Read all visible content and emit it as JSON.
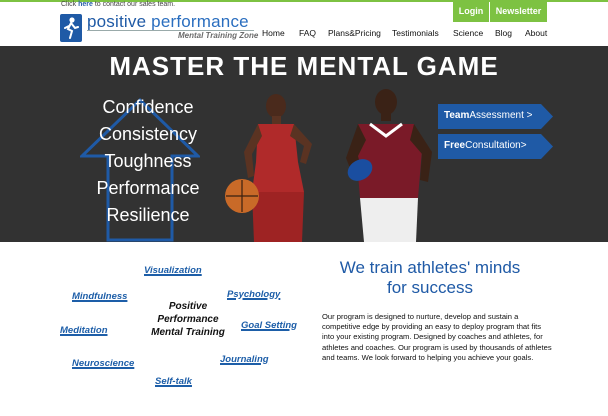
{
  "header": {
    "contact_link": "here",
    "contact_suffix": " to contact our sales team.",
    "contact_prefix": "Click ",
    "logo_name_1": "positive",
    "logo_name_2": " performance",
    "logo_tagline": "Mental Training Zone",
    "login_label": "Login",
    "newsletter_label": "Newsletter",
    "nav": [
      "Home",
      "FAQ",
      "Plans&Pricing",
      "Testimonials",
      "Science",
      "Blog",
      "About"
    ]
  },
  "hero": {
    "title": "MASTER THE MENTAL GAME",
    "words": [
      "Confidence",
      "Consistency",
      "Toughness",
      "Performance",
      "Resilience"
    ],
    "cta_team_bold": "Team",
    "cta_team_rest": "Assessment >",
    "cta_free_bold": "Free",
    "cta_free_rest": "Consultation>"
  },
  "cloud": {
    "center": [
      "Positive",
      "Performance",
      "Mental Training"
    ],
    "visualization": "Visualization",
    "mindfulness": "Mindfulness",
    "psychology": "Psychology",
    "meditation": "Meditation",
    "goal_setting": "Goal Setting",
    "neuroscience": "Neuroscience",
    "journaling": "Journaling",
    "self_talk": "Self-talk"
  },
  "intro": {
    "headline_1": "We train athletes' minds",
    "headline_2": "for success",
    "body": "Our program is designed to nurture, develop and sustain a competitive edge by providing an easy to deploy program that fits into your existing program. Designed by coaches and athletes, for athletes and coaches. Our program is used by thousands of athletes and teams. We look forward to helping you achieve your goals."
  },
  "colors": {
    "accent_green": "#7dc242",
    "brand_blue": "#1f5aa6",
    "hero_bg": "#323232"
  }
}
